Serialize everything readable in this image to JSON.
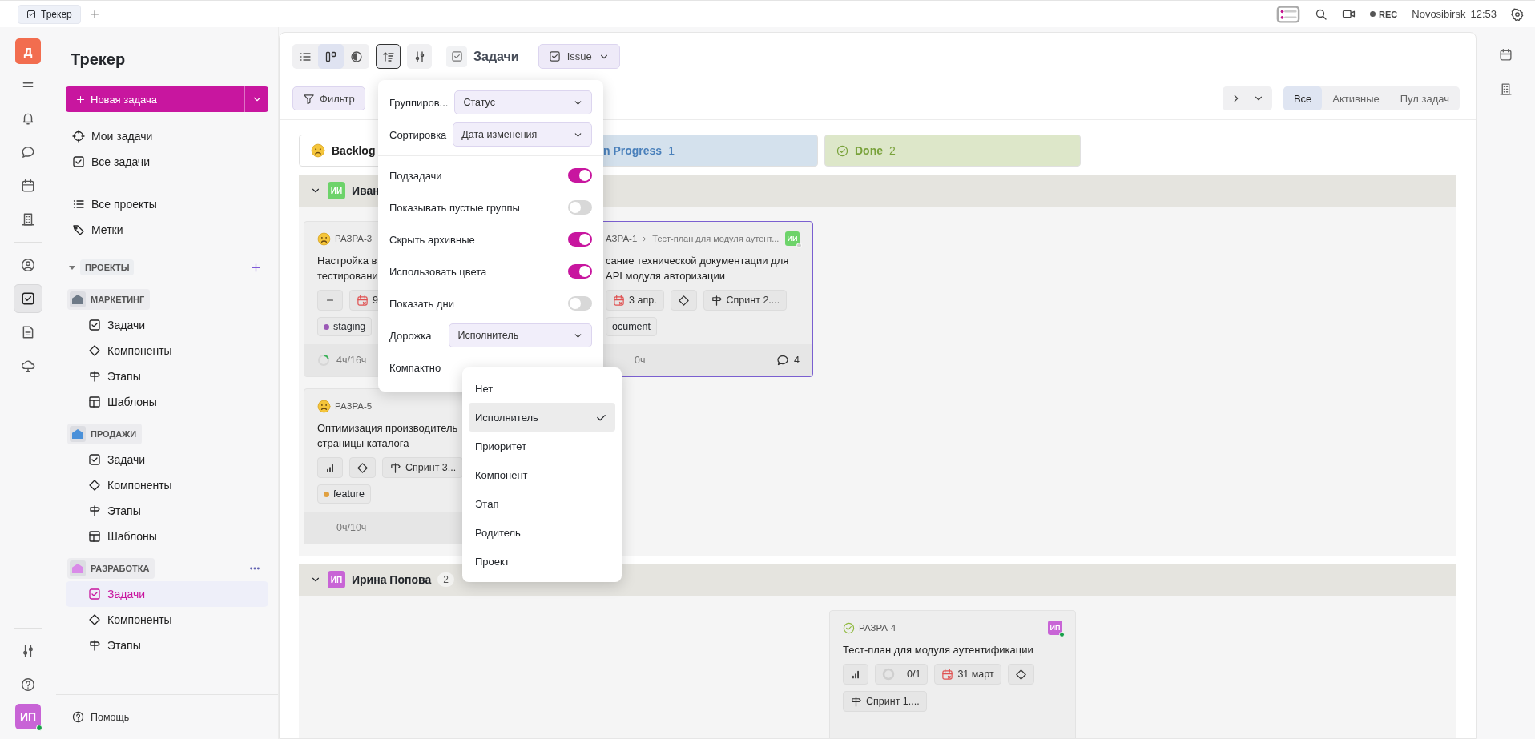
{
  "top_bar": {
    "tabs": [
      {
        "label": "Трекер",
        "selected": true
      }
    ],
    "rec": "REC",
    "city": "Novosibirsk",
    "time": "12:53"
  },
  "rail": {
    "workspace": "Д",
    "sections": [
      [
        {
          "kind": "menu",
          "selected": false
        },
        {
          "kind": "bell",
          "selected": false
        },
        {
          "kind": "chat",
          "selected": false
        },
        {
          "kind": "calendar",
          "selected": false
        },
        {
          "kind": "building",
          "selected": false
        }
      ],
      [
        {
          "kind": "person",
          "selected": false
        },
        {
          "kind": "tasks",
          "selected": true
        },
        {
          "kind": "doc",
          "selected": false
        },
        {
          "kind": "cloud",
          "selected": false
        }
      ]
    ],
    "bottom": [
      {
        "kind": "sliders"
      },
      {
        "kind": "help"
      }
    ],
    "user": {
      "initials": "ИП",
      "online": true
    }
  },
  "sidebar": {
    "title": "Трекер",
    "new_task": "Новая задача",
    "nav": [
      [
        {
          "kind": "target",
          "label": "Мои задачи"
        },
        {
          "kind": "check",
          "label": "Все задачи"
        }
      ],
      [
        {
          "kind": "list",
          "label": "Все проекты"
        },
        {
          "kind": "tag",
          "label": "Метки"
        }
      ]
    ],
    "projects_heading": "ПРОЕКТЫ",
    "projects": [
      {
        "name": "МАРКЕТИНГ",
        "color": "#6e7a87",
        "hovered": false,
        "items": [
          {
            "kind": "check",
            "label": "Задачи",
            "selected": false
          },
          {
            "kind": "diamond",
            "label": "Компоненты",
            "selected": false
          },
          {
            "kind": "signpost",
            "label": "Этапы",
            "selected": false
          },
          {
            "kind": "template",
            "label": "Шаблоны",
            "selected": false
          }
        ]
      },
      {
        "name": "ПРОДАЖИ",
        "color": "#4a90d9",
        "hovered": false,
        "items": [
          {
            "kind": "check",
            "label": "Задачи",
            "selected": false
          },
          {
            "kind": "diamond",
            "label": "Компоненты",
            "selected": false
          },
          {
            "kind": "signpost",
            "label": "Этапы",
            "selected": false
          },
          {
            "kind": "template",
            "label": "Шаблоны",
            "selected": false
          }
        ]
      },
      {
        "name": "РАЗРАБОТКА",
        "color": "#d98ae8",
        "hovered": true,
        "items": [
          {
            "kind": "check",
            "label": "Задачи",
            "selected": true
          },
          {
            "kind": "diamond",
            "label": "Компоненты",
            "selected": false
          },
          {
            "kind": "signpost",
            "label": "Этапы",
            "selected": false
          }
        ]
      }
    ],
    "help": "Помощь"
  },
  "toolbar": {
    "views": [
      {
        "kind": "list",
        "selected": false
      },
      {
        "kind": "board",
        "selected": true
      },
      {
        "kind": "timeline",
        "selected": false
      }
    ],
    "sort_open": true,
    "title": "Задачи",
    "type": "Issue"
  },
  "filter_bar": {
    "filter": "Фильтр",
    "segments": [
      {
        "label": "Все",
        "selected": true
      },
      {
        "label": "Активные",
        "selected": false
      },
      {
        "label": "Пул задач",
        "selected": false
      }
    ]
  },
  "board": {
    "columns": [
      {
        "kind": "backlog",
        "name": "Backlog",
        "color": "#ffffff"
      },
      {
        "kind": "progress",
        "name": "n Progress",
        "count": "1",
        "color": "#d4e1ed"
      },
      {
        "kind": "done",
        "name": "Done",
        "count": "2",
        "color": "#dde7c9"
      }
    ],
    "groups": [
      {
        "name": "Иван",
        "initials": "ИИ",
        "color": "#6dd36a",
        "cards": [
          {
            "kind": "backlog",
            "key": "РАЗРА-3",
            "title": "Настройка в\nтестировани",
            "selected": false,
            "chips": [
              {
                "kind": "none"
              },
              {
                "kind": "date",
                "text": "9"
              }
            ],
            "labels": [
              {
                "text": "staging",
                "color": "#9b59b6"
              }
            ],
            "footer": {
              "time": "4ч/16ч",
              "level": 0.2
            }
          },
          {
            "kind": "backlog",
            "key": "РАЗРА-5",
            "title": "Оптимизация производитель\nстраницы каталога",
            "selected": false,
            "chips": [
              {
                "kind": "priority"
              },
              {
                "kind": "component"
              },
              {
                "kind": "sprint",
                "text": "Спринт 3..."
              }
            ],
            "labels": [
              {
                "text": "feature",
                "color": "#e0a040"
              }
            ],
            "footer": {
              "time": "0ч/10ч"
            }
          },
          {
            "kind": "progress",
            "key": "АЗРА-1",
            "parent": "Тест-план для модуля аутент...",
            "assignee": {
              "initials": "ИИ",
              "color": "#6dd36a",
              "online": false
            },
            "title": "сание технической документации для\nAPI модуля авторизации",
            "selected": true,
            "chips": [
              {
                "kind": "date",
                "text": "3 апр."
              },
              {
                "kind": "component"
              },
              {
                "kind": "sprint",
                "text": "Спринт 2...."
              }
            ],
            "labels": [
              {
                "text": "ocument"
              }
            ],
            "footer": {
              "time": "0ч",
              "comments": "4"
            }
          }
        ]
      },
      {
        "name": "Ирина Попова",
        "initials": "ИП",
        "color": "#c864d6",
        "count": "2",
        "cards": [
          {
            "kind": "done",
            "key": "РАЗРА-4",
            "assignee": {
              "initials": "ИП",
              "color": "#c864d6",
              "online": true
            },
            "title": "Тест-план для модуля аутентификации",
            "selected": false,
            "chips": [
              {
                "kind": "priority"
              },
              {
                "kind": "subtasks",
                "text": "0/1"
              },
              {
                "kind": "date",
                "text": "31 март"
              },
              {
                "kind": "component"
              },
              {
                "kind": "sprint",
                "text": "Спринт 1...."
              }
            ]
          }
        ]
      }
    ]
  },
  "popover": {
    "selects": [
      {
        "label": "Группиров...",
        "value": "Статус"
      },
      {
        "label": "Сортировка",
        "value": "Дата изменения"
      }
    ],
    "rows": [
      {
        "kind": "toggle",
        "label": "Подзадачи",
        "on": true
      },
      {
        "kind": "toggle",
        "label": "Показывать пустые группы",
        "on": false
      },
      {
        "kind": "toggle",
        "label": "Скрыть архивные",
        "on": true
      },
      {
        "kind": "toggle",
        "label": "Использовать цвета",
        "on": true
      },
      {
        "kind": "toggle",
        "label": "Показать дни",
        "on": false
      },
      {
        "kind": "select",
        "label": "Дорожка",
        "value": "Исполнитель"
      },
      {
        "kind": "toggle",
        "label": "Компактно"
      }
    ]
  },
  "dropdown": {
    "options": [
      {
        "label": "Нет",
        "selected": false
      },
      {
        "label": "Исполнитель",
        "selected": true
      },
      {
        "label": "Приоритет",
        "selected": false
      },
      {
        "label": "Компонент",
        "selected": false
      },
      {
        "label": "Этап",
        "selected": false
      },
      {
        "label": "Родитель",
        "selected": false
      },
      {
        "label": "Проект",
        "selected": false
      }
    ]
  }
}
